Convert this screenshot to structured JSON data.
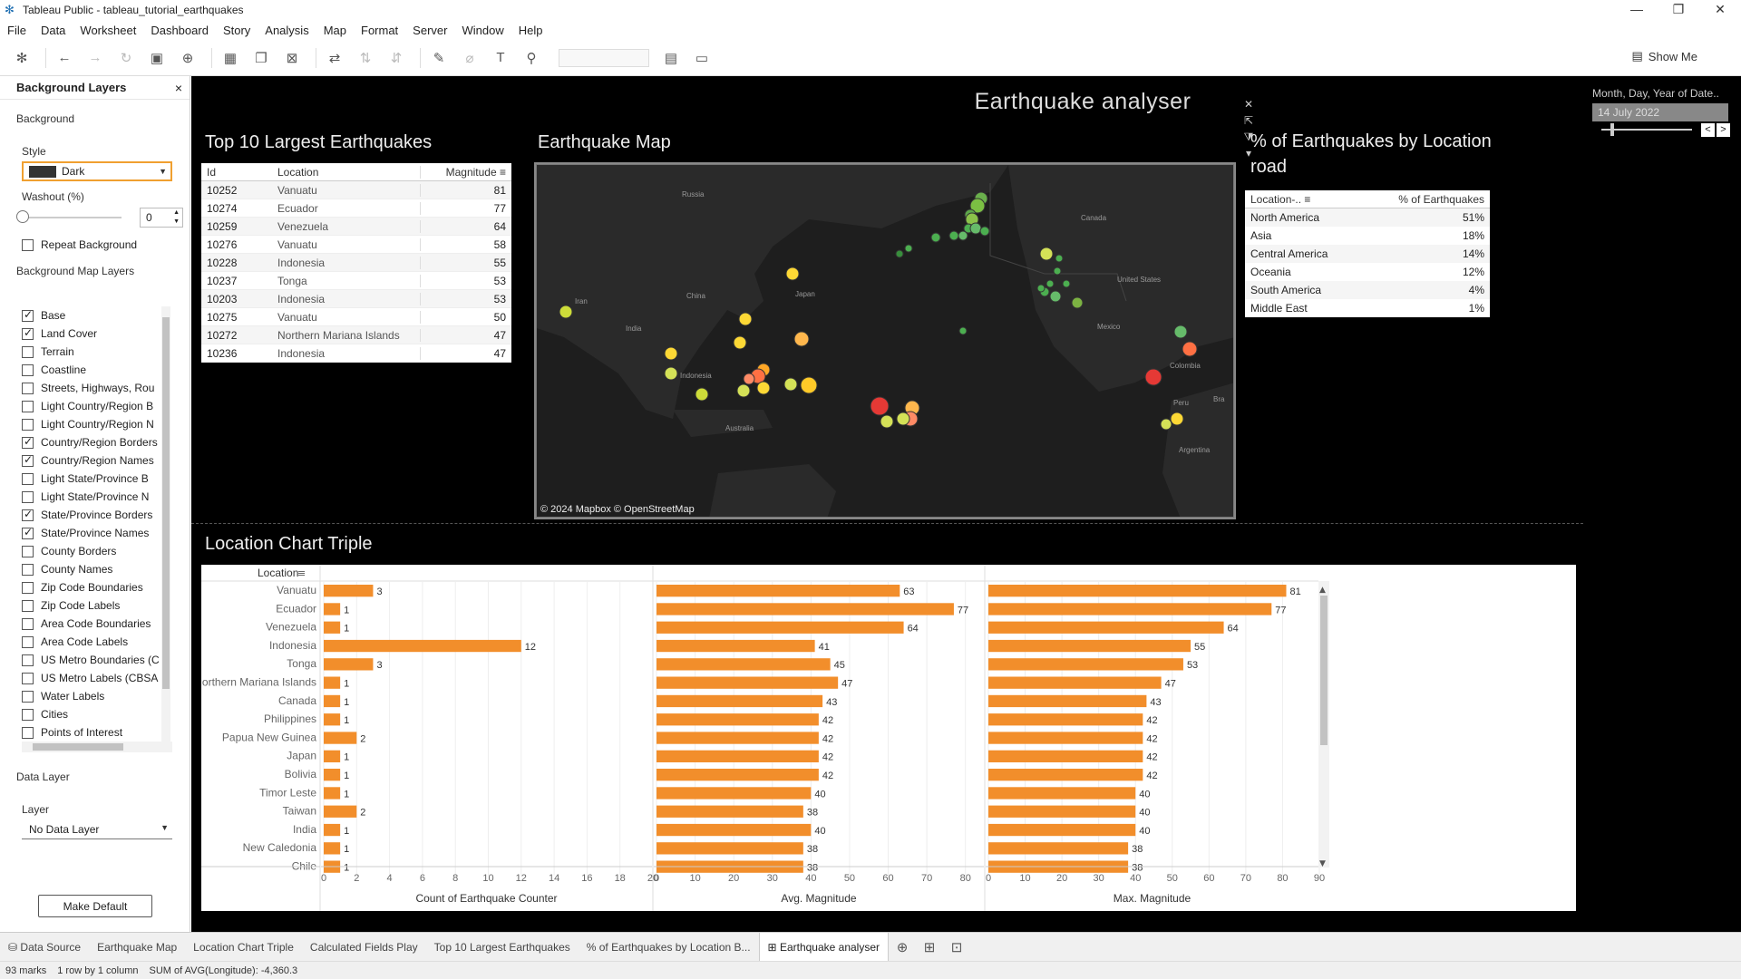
{
  "window": {
    "title": "Tableau Public - tableau_tutorial_earthquakes",
    "minimize": "—",
    "restore": "❐",
    "close": "✕"
  },
  "menu": [
    "File",
    "Data",
    "Worksheet",
    "Dashboard",
    "Story",
    "Analysis",
    "Map",
    "Format",
    "Server",
    "Window",
    "Help"
  ],
  "toolbar": {
    "show_me": "Show Me"
  },
  "left_panel": {
    "title": "Background Layers",
    "close": "×",
    "background_label": "Background",
    "style_label": "Style",
    "style_value": "Dark",
    "washout_label": "Washout (%)",
    "washout_value": "0",
    "repeat_label": "Repeat Background",
    "map_layers_label": "Background Map Layers",
    "layers": [
      {
        "label": "Base",
        "checked": true
      },
      {
        "label": "Land Cover",
        "checked": true
      },
      {
        "label": "Terrain",
        "checked": false
      },
      {
        "label": "Coastline",
        "checked": false
      },
      {
        "label": "Streets, Highways, Rou",
        "checked": false
      },
      {
        "label": "Light Country/Region B",
        "checked": false
      },
      {
        "label": "Light Country/Region N",
        "checked": false
      },
      {
        "label": "Country/Region Borders",
        "checked": true
      },
      {
        "label": "Country/Region Names",
        "checked": true
      },
      {
        "label": "Light State/Province B",
        "checked": false
      },
      {
        "label": "Light State/Province N",
        "checked": false
      },
      {
        "label": "State/Province Borders",
        "checked": true
      },
      {
        "label": "State/Province Names",
        "checked": true
      },
      {
        "label": "County Borders",
        "checked": false
      },
      {
        "label": "County Names",
        "checked": false
      },
      {
        "label": "Zip Code Boundaries",
        "checked": false
      },
      {
        "label": "Zip Code Labels",
        "checked": false
      },
      {
        "label": "Area Code Boundaries",
        "checked": false
      },
      {
        "label": "Area Code Labels",
        "checked": false
      },
      {
        "label": "US Metro Boundaries (C",
        "checked": false
      },
      {
        "label": "US Metro Labels (CBSA",
        "checked": false
      },
      {
        "label": "Water Labels",
        "checked": false
      },
      {
        "label": "Cities",
        "checked": false
      },
      {
        "label": "Points of Interest",
        "checked": false
      }
    ],
    "data_layer_label": "Data Layer",
    "layer_label": "Layer",
    "layer_value": "No Data Layer",
    "make_default": "Make Default"
  },
  "dashboard": {
    "title": "Earthquake analyser",
    "top10": {
      "title": "Top 10 Largest Earthquakes",
      "headers": [
        "Id",
        "Location",
        "Magnitude"
      ],
      "rows": [
        [
          "10252",
          "Vanuatu",
          "81"
        ],
        [
          "10274",
          "Ecuador",
          "77"
        ],
        [
          "10259",
          "Venezuela",
          "64"
        ],
        [
          "10276",
          "Vanuatu",
          "58"
        ],
        [
          "10228",
          "Indonesia",
          "55"
        ],
        [
          "10237",
          "Tonga",
          "53"
        ],
        [
          "10203",
          "Indonesia",
          "53"
        ],
        [
          "10275",
          "Vanuatu",
          "50"
        ],
        [
          "10272",
          "Northern Mariana Islands",
          "47"
        ],
        [
          "10236",
          "Indonesia",
          "47"
        ]
      ]
    },
    "map": {
      "title": "Earthquake Map",
      "credit": "© 2024 Mapbox © OpenStreetMap",
      "labels": [
        "Russia",
        "Canada",
        "United States",
        "China",
        "Japan",
        "Iran",
        "India",
        "Mexico",
        "Colombia",
        "Indonesia",
        "Australia",
        "Peru",
        "Argentina",
        "Bra"
      ]
    },
    "pct": {
      "title_line1": "% of Earthquakes by Location",
      "title_line2": "road",
      "headers": [
        "Location-..",
        "% of Earthquakes"
      ],
      "rows": [
        [
          "North America",
          "51%"
        ],
        [
          "Asia",
          "18%"
        ],
        [
          "Central America",
          "14%"
        ],
        [
          "Oceania",
          "12%"
        ],
        [
          "South America",
          "4%"
        ],
        [
          "Middle East",
          "1%"
        ]
      ]
    },
    "date_filter": {
      "label": "Month, Day, Year of Date..",
      "value": "14 July 2022",
      "prev": "<",
      "next": ">"
    },
    "location_chart": {
      "title": "Location Chart Triple"
    }
  },
  "chart_data": {
    "type": "bar",
    "title": "Location Chart Triple",
    "row_header": "Location",
    "categories": [
      "Vanuatu",
      "Ecuador",
      "Venezuela",
      "Indonesia",
      "Tonga",
      "Northern Mariana Islands",
      "Canada",
      "Philippines",
      "Papua New Guinea",
      "Japan",
      "Bolivia",
      "Timor Leste",
      "Taiwan",
      "India",
      "New Caledonia",
      "Chile"
    ],
    "panels": [
      {
        "xlabel": "Count of Earthquake Counter",
        "xlim": [
          0,
          20
        ],
        "ticks": [
          0,
          2,
          4,
          6,
          8,
          10,
          12,
          14,
          16,
          18,
          20
        ],
        "values": [
          3,
          1,
          1,
          12,
          3,
          1,
          1,
          1,
          2,
          1,
          1,
          1,
          2,
          1,
          1,
          1
        ]
      },
      {
        "xlabel": "Avg. Magnitude",
        "xlim": [
          0,
          85
        ],
        "ticks": [
          0,
          10,
          20,
          30,
          40,
          50,
          60,
          70,
          80
        ],
        "values": [
          63,
          77,
          64,
          41,
          45,
          47,
          43,
          42,
          42,
          42,
          42,
          40,
          38,
          40,
          38,
          38
        ]
      },
      {
        "xlabel": "Max. Magnitude",
        "xlim": [
          0,
          90
        ],
        "ticks": [
          0,
          10,
          20,
          30,
          40,
          50,
          60,
          70,
          80,
          90
        ],
        "values": [
          81,
          77,
          64,
          55,
          53,
          47,
          43,
          42,
          42,
          42,
          42,
          40,
          40,
          40,
          38,
          38
        ]
      }
    ],
    "bar_color": "#f28e2b"
  },
  "tabs": [
    "Data Source",
    "Earthquake Map",
    "Location Chart Triple",
    "Calculated Fields Play",
    "Top 10 Largest Earthquakes",
    "% of Earthquakes by Location B...",
    "Earthquake analyser"
  ],
  "status": {
    "marks": "93 marks",
    "rows": "1 row by 1 column",
    "sum": "SUM of AVG(Longitude): -4,360.3"
  }
}
